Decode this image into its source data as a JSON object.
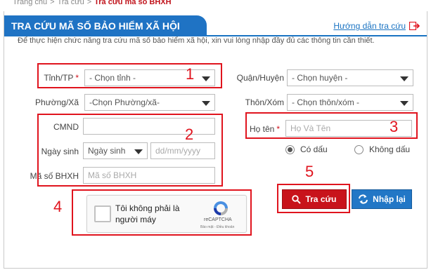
{
  "breadcrumb": {
    "items": [
      "Trang chủ",
      "Tra cứu"
    ],
    "current": "Tra cứu mã số BHXH",
    "separator": ">"
  },
  "header": {
    "title": "TRA CỨU MÃ SỐ BẢO HIỂM XÃ HỘI",
    "guide_link": "Hướng dẫn tra cứu"
  },
  "intro": "Để thực hiện chức năng tra cứu mã số bảo hiểm xã hội, xin vui lòng nhập đầy đủ các thông tin cần thiết.",
  "form": {
    "province": {
      "label": "Tỉnh/TP",
      "required_mark": "*",
      "value": "- Chọn tỉnh -"
    },
    "district": {
      "label": "Quận/Huyện",
      "value": "- Chọn huyện -"
    },
    "ward": {
      "label": "Phường/Xã",
      "value": "-Chọn Phường/xã-"
    },
    "village": {
      "label": "Thôn/Xóm",
      "value": "- Chọn thôn/xóm -"
    },
    "id_card": {
      "label": "CMND",
      "value": ""
    },
    "birth": {
      "label": "Ngày sinh",
      "select_value": "Ngày sinh",
      "placeholder": "dd/mm/yyyy"
    },
    "bhxh": {
      "label": "Mã số BHXH",
      "placeholder": "Mã số BHXH"
    },
    "fullname": {
      "label": "Họ tên",
      "required_mark": "*",
      "placeholder": "Họ Và Tên"
    },
    "accent": {
      "with": "Có dấu",
      "without": "Không dấu",
      "selected": "with"
    }
  },
  "captcha": {
    "label": "Tôi không phải là người máy",
    "brand": "reCAPTCHA",
    "terms": "Bảo mật - Điều khoản"
  },
  "buttons": {
    "search": "Tra cứu",
    "reset": "Nhập lại"
  },
  "annotations": [
    "1",
    "2",
    "3",
    "4",
    "5"
  ],
  "colors": {
    "brand_blue": "#1f73c4",
    "annotation_red": "#e0141e",
    "search_red": "#c8131b",
    "reset_blue": "#2277c6"
  }
}
